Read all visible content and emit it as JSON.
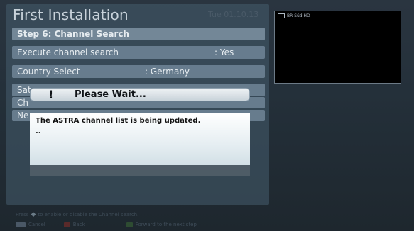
{
  "screen": {
    "title": "First Installation",
    "clock": "Tue 01.10.13",
    "step_label": "Step 6: Channel Search",
    "rows": [
      {
        "label": "Execute channel search",
        "value": ": Yes"
      },
      {
        "label": "Country Select",
        "value": ": Germany"
      },
      {
        "label": "Sat",
        "value": ""
      },
      {
        "label": "Ch",
        "value": ""
      },
      {
        "label": "Ne",
        "value": ""
      }
    ]
  },
  "preview": {
    "channel_label": "BR Süd HD"
  },
  "dialog": {
    "icon": "!",
    "title": "Please Wait...",
    "message": "The ASTRA channel list is being updated.",
    "progress_dots": ".."
  },
  "hints": {
    "line1": "Press",
    "line1_rest": "to enable or disable the Channel search.",
    "keys": [
      {
        "key": "EXIT",
        "label": "Cancel"
      },
      {
        "key": "red",
        "label": "Back"
      },
      {
        "key": "green",
        "label": "Forward to the next step"
      }
    ]
  },
  "colors": {
    "panel": "#465c6e",
    "row": "#788ea0",
    "dialog_title": "#dde4e9",
    "dialog_body": "#ffffff"
  }
}
